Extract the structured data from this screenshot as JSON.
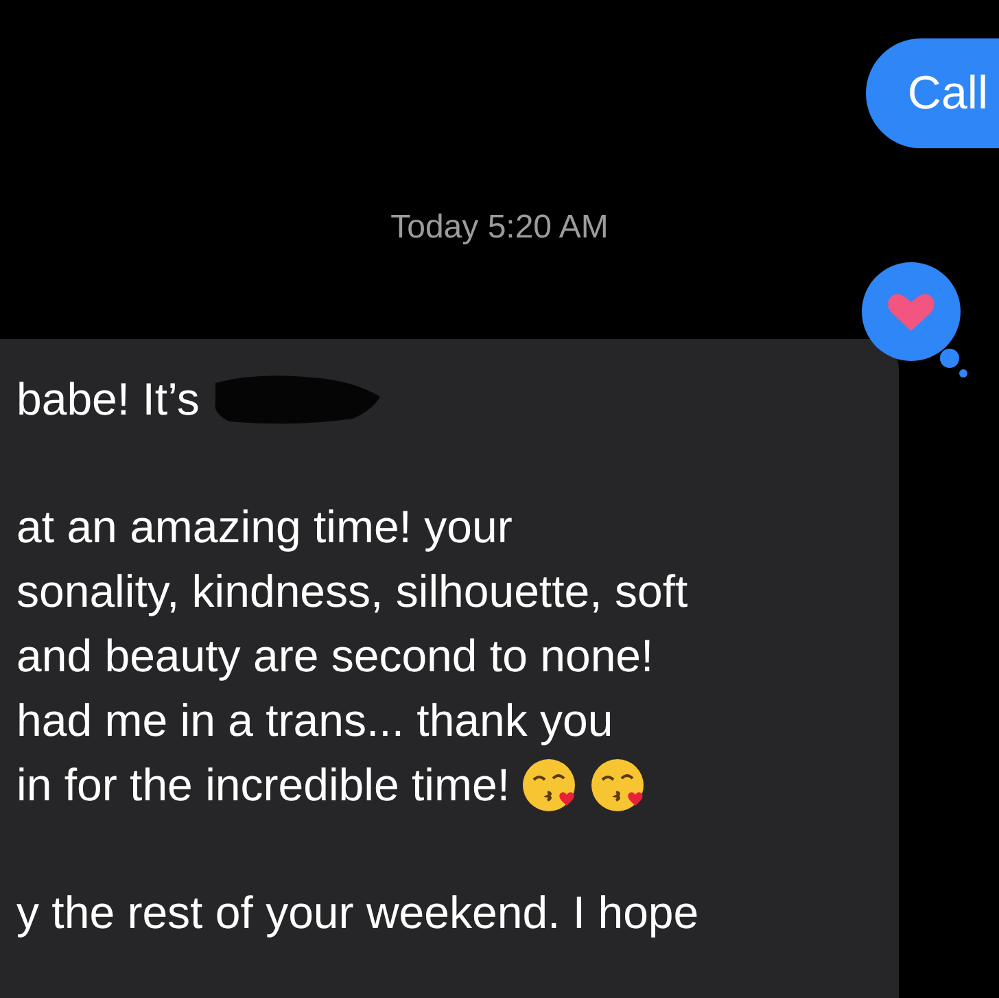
{
  "sent_message": {
    "text": "Call"
  },
  "timestamp": "Today 5:20 AM",
  "received_message": {
    "reaction": {
      "kind": "heart"
    },
    "paragraphs": [
      [
        {
          "text": "babe! It’s",
          "redacted": true
        }
      ],
      [
        {
          "text": "at an amazing time! your",
          "redacted": false
        },
        {
          "text": "sonality, kindness, silhouette, soft",
          "redacted": false
        },
        {
          "text": "and beauty are second to none!",
          "redacted": false
        },
        {
          "text": "had me in a trans... thank you",
          "redacted": false
        },
        {
          "text": "in for the incredible time!",
          "redacted": false,
          "emojis": [
            {
              "kind": "kiss"
            },
            {
              "kind": "kiss"
            }
          ]
        }
      ],
      [
        {
          "text": "y the rest of your weekend. I hope",
          "redacted": false
        }
      ]
    ]
  }
}
